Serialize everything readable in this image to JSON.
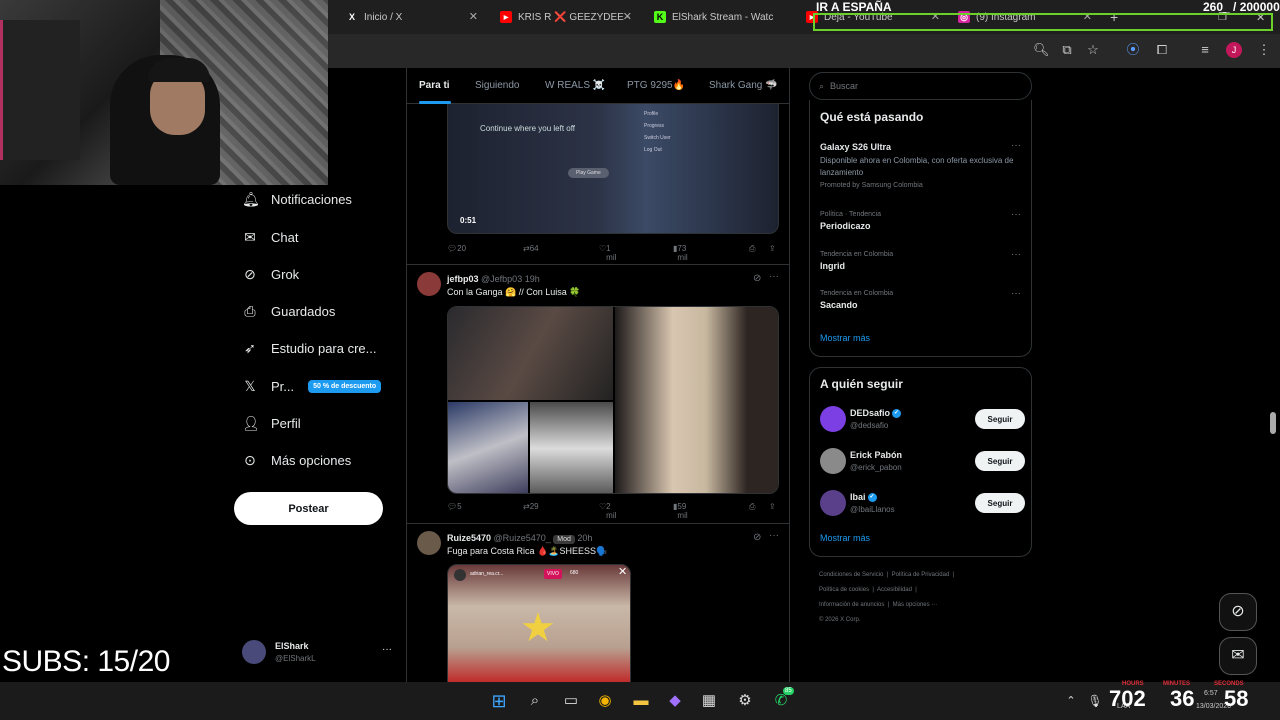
{
  "browser": {
    "tabs": [
      {
        "icon": "X",
        "label": "Inicio / X"
      },
      {
        "icon": "▶",
        "label": "KRIS R ❌ GEEZYDEE -"
      },
      {
        "icon": "K",
        "label": "ElShark Stream - Watc"
      },
      {
        "icon": "▶",
        "label": "Deja - YouTube"
      },
      {
        "icon": "◎",
        "label": "(9) Instagram"
      }
    ]
  },
  "overlay": {
    "top_title": "IR A ESPAÑA",
    "top_counter": "260_ / 200000",
    "subs": "SUBS: 15/20",
    "timer_labels": {
      "hours": "HOURS",
      "minutes": "MINUTES",
      "seconds": "SECONDS"
    },
    "timer": {
      "hours": "702",
      "minutes": "36",
      "seconds": "58"
    }
  },
  "nav": {
    "items": [
      {
        "icon": "bell",
        "label": "Notificaciones"
      },
      {
        "icon": "mail",
        "label": "Chat"
      },
      {
        "icon": "grok",
        "label": "Grok"
      },
      {
        "icon": "bookmark",
        "label": "Guardados"
      },
      {
        "icon": "rocket",
        "label": "Estudio para cre..."
      },
      {
        "icon": "x",
        "label": "Pr...",
        "badge": "50 % de descuento"
      },
      {
        "icon": "person",
        "label": "Perfil"
      },
      {
        "icon": "more",
        "label": "Más opciones"
      }
    ],
    "post_button": "Postear",
    "account": {
      "name": "ElShark",
      "handle": "@ElSharkL"
    }
  },
  "feed": {
    "tabs": [
      "Para ti",
      "Siguiendo",
      "W REALS ☠️",
      "PTG 9295🔥",
      "Shark Gang 🦈"
    ],
    "tweet1": {
      "video_time": "0:51",
      "video_text": "Continue where you left off",
      "menu": [
        "Profile",
        "Progress",
        "Switch User",
        "Log Out"
      ],
      "play": "Play Game",
      "actions": {
        "replies": "20",
        "reposts": "64",
        "likes": "1 mil",
        "views": "73 mil"
      }
    },
    "tweet2": {
      "name": "jefbp03",
      "handle": "@Jefbp03",
      "time": "19h",
      "text": "Con la Ganga 🤗        //        Con Luisa 🍀",
      "actions": {
        "replies": "5",
        "reposts": "29",
        "likes": "2 mil",
        "views": "59 mil"
      }
    },
    "tweet3": {
      "name": "Ruize5470",
      "handle": "@Ruize5470_",
      "badge": "Mod",
      "time": "20h",
      "text": "Fuga para Costa Rica 🩸🏝️SHEESS🗣️",
      "live_user": "adrian_rea.cr...",
      "live_tag": "VIVO",
      "live_viewers": "680"
    }
  },
  "right": {
    "search_placeholder": "Buscar",
    "trends_title": "Qué está pasando",
    "trends": [
      {
        "category": "",
        "name": "Galaxy S26 Ultra",
        "desc": "Disponible ahora en Colombia, con oferta exclusiva de lanzamiento",
        "promo": "Promoted by Samsung Colombia"
      },
      {
        "category": "Política · Tendencia",
        "name": "Periodicazo"
      },
      {
        "category": "Tendencia en Colombia",
        "name": "Ingrid"
      },
      {
        "category": "Tendencia en Colombia",
        "name": "Sacando"
      }
    ],
    "show_more": "Mostrar más",
    "who_to_follow_title": "A quién seguir",
    "follow": [
      {
        "name": "DEDsafio",
        "handle": "@dedsafio",
        "verified": true,
        "button": "Seguir"
      },
      {
        "name": "Erick Pabón",
        "handle": "@erick_pabon",
        "verified": false,
        "button": "Seguir"
      },
      {
        "name": "Ibai",
        "handle": "@IbaiLlanos",
        "verified": true,
        "button": "Seguir"
      }
    ],
    "follow_more": "Mostrar más",
    "footer": [
      "Condiciones de Servicio",
      "Política de Privacidad",
      "Política de cookies",
      "Accesibilidad",
      "Información de anuncios",
      "Más opciones ···",
      "© 2026 X Corp."
    ]
  },
  "taskbar": {
    "whatsapp_badge": "85",
    "tray": {
      "lang": "LAA",
      "time": "6:57",
      "date": "13/03/2026"
    }
  },
  "colors": {
    "accent": "#1d9bf0",
    "border": "#2f3336",
    "muted": "#71767b",
    "overlay_green": "#6bd12a",
    "timer_red": "#e0303a"
  }
}
